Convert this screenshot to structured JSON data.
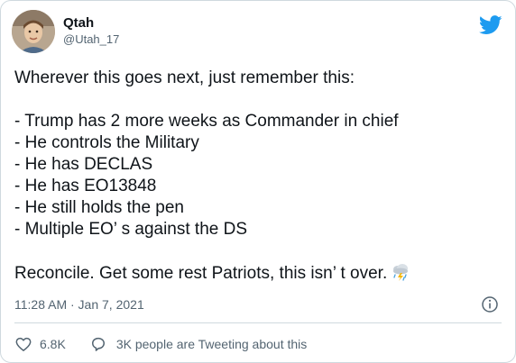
{
  "author": {
    "display_name": "Qtah",
    "handle": "@Utah_17"
  },
  "tweet": {
    "intro": "Wherever this goes next, just remember this:",
    "points": [
      "- Trump has 2 more weeks as Commander in chief",
      "- He controls the Military",
      "- He has DECLAS",
      "- He has EO13848",
      "- He still holds the pen",
      "- Multiple EO’ s against the DS"
    ],
    "closing": "Reconcile. Get some rest Patriots, this isn’ t over."
  },
  "meta": {
    "timestamp": "11:28 AM · Jan 7, 2021"
  },
  "actions": {
    "like_count": "6.8K",
    "conversation_label": "3K people are Tweeting about this"
  },
  "icons": {
    "logo": "twitter-bird-icon",
    "info": "info-icon",
    "like": "heart-icon",
    "reply": "speech-bubble-icon",
    "emoji": "cloud-lightning-rain-emoji"
  },
  "colors": {
    "brand_blue": "#1d9bf0",
    "text_primary": "#0f1419",
    "text_secondary": "#536471",
    "border": "#cfd9de"
  }
}
